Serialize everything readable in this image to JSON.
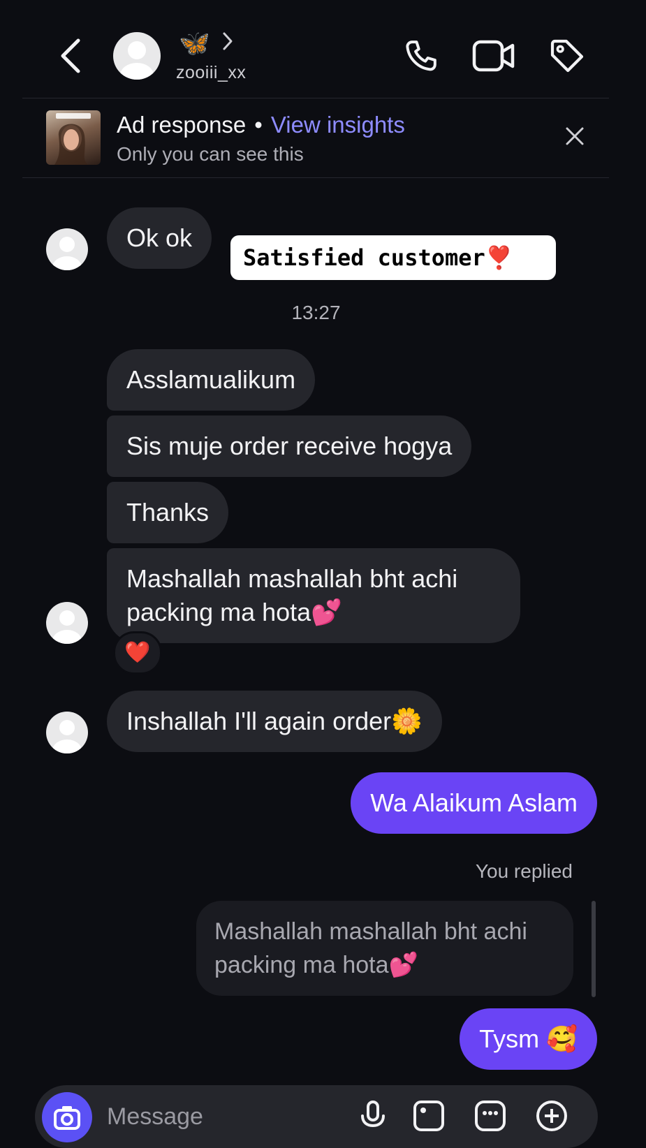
{
  "header": {
    "butterfly": "🦋",
    "username": "zooiii_xx"
  },
  "ad_banner": {
    "title": "Ad response",
    "separator": "•",
    "link": "View insights",
    "subtitle": "Only you can see this"
  },
  "sticker": {
    "text": "Satisfied customer❣️"
  },
  "messages": {
    "ok": "Ok ok",
    "timestamp": "13:27",
    "m1": "Asslamualikum",
    "m2": "Sis muje order receive hogya",
    "m3": "Thanks",
    "m4_line1": "Mashallah mashallah bht achi",
    "m4_line2": "packing ma hota💕",
    "m4_reaction": "❤️",
    "m5": "Inshallah I'll again order🌼",
    "out1": "Wa Alaikum Aslam",
    "you_replied": "You replied",
    "quote_line1": "Mashallah mashallah bht achi",
    "quote_line2": "packing ma hota💕",
    "out2": "Tysm 🥰"
  },
  "composer": {
    "placeholder": "Message"
  },
  "colors": {
    "background": "#0c0d12",
    "incoming_bubble": "#25262c",
    "outgoing_bubble": "#6a44f5",
    "link": "#8e8cff"
  }
}
